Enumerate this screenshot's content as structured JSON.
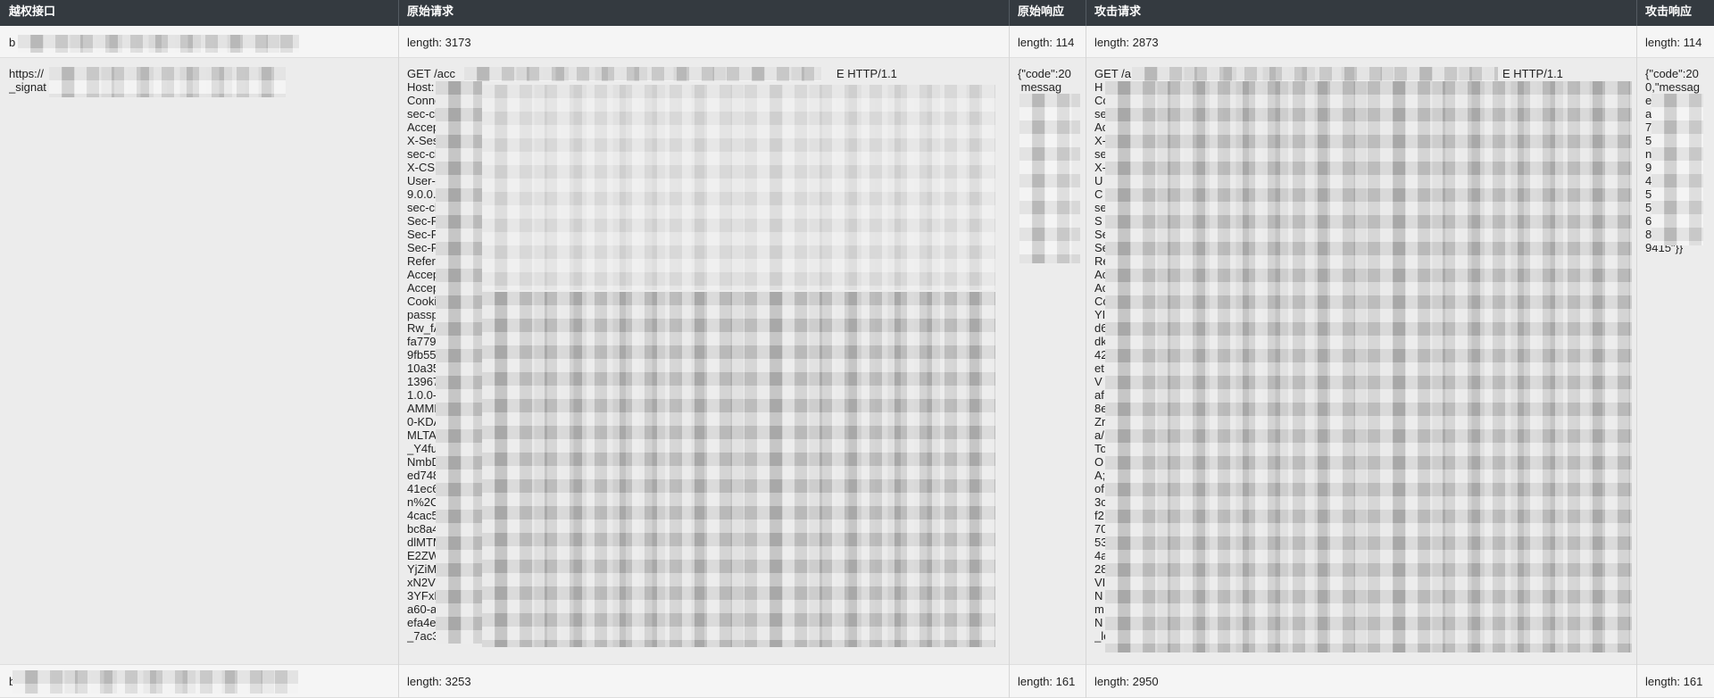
{
  "columns": [
    "越权接口",
    "原始请求",
    "原始响应",
    "攻击请求",
    "攻击响应"
  ],
  "rows": [
    {
      "endpoint": "b",
      "orig_request": "length: 3173",
      "orig_response": "length: 114",
      "attack_request": "length: 2873",
      "attack_response": "length: 114"
    },
    {
      "endpoint": "https://\n_signat",
      "orig_request": "GET /acc\nHost: \nConne\nsec-cl\nAccep\nX-Ses\nsec-cl\nX-CSR\nUser-A\n9.0.0.0\nsec-cl\nSec-F\nSec-F\nSec-F\nRefere\nAccep\nAccep\nCookie\npassp\nRw_fA\nfa7797\n9fb55\n10a35\n13967\n1.0.0-k\nAMML\n0-KDA\nMLTA_\n_Y4ful\nNmbD\ned748\n41ec6\nn%2C\n4cac5\nbc8a4\ndlMTM\nE2ZW\nYjZiMj\nxN2Vi\n3YFxE\na60-a\nefa4e5\n_7ac3",
      "orig_request_tail": "E HTTP/1.1",
      "orig_response": "{\"code\":20\n messag\n OK\",\"d",
      "attack_request": "GET /a\nH\nCo\nse\nAc\nX-\nse\nX-\nU\nC\nse\nS\nSe\nSe\nRe\nAc\nAc\nCo\nYI\nd6\ndk\n42\net\nV\naf\n8e\nZr\na/\nTo\nO\nA;\nof\n3c\nf2\n70\n53\n4a\n28\nVI\nN\nm\nN\n_le",
      "attack_request_tail": "E HTTP/1.1",
      "attack_response": "{\"code\":20\n0,\"messag\ne\na\n7\n5\nn\n9\n4\n5\n5\n6\n8\n9415\"}}"
    },
    {
      "endpoint": "b",
      "orig_request": "length: 3253",
      "orig_response": "length: 161",
      "attack_request": "length: 2950",
      "attack_response": "length: 161"
    }
  ],
  "colors": {
    "header_bg": "#343a40",
    "header_text": "#ffffff",
    "row_bg": "#f5f5f5",
    "alt_row_bg": "#ececec",
    "redaction": "#c9c9c9"
  }
}
